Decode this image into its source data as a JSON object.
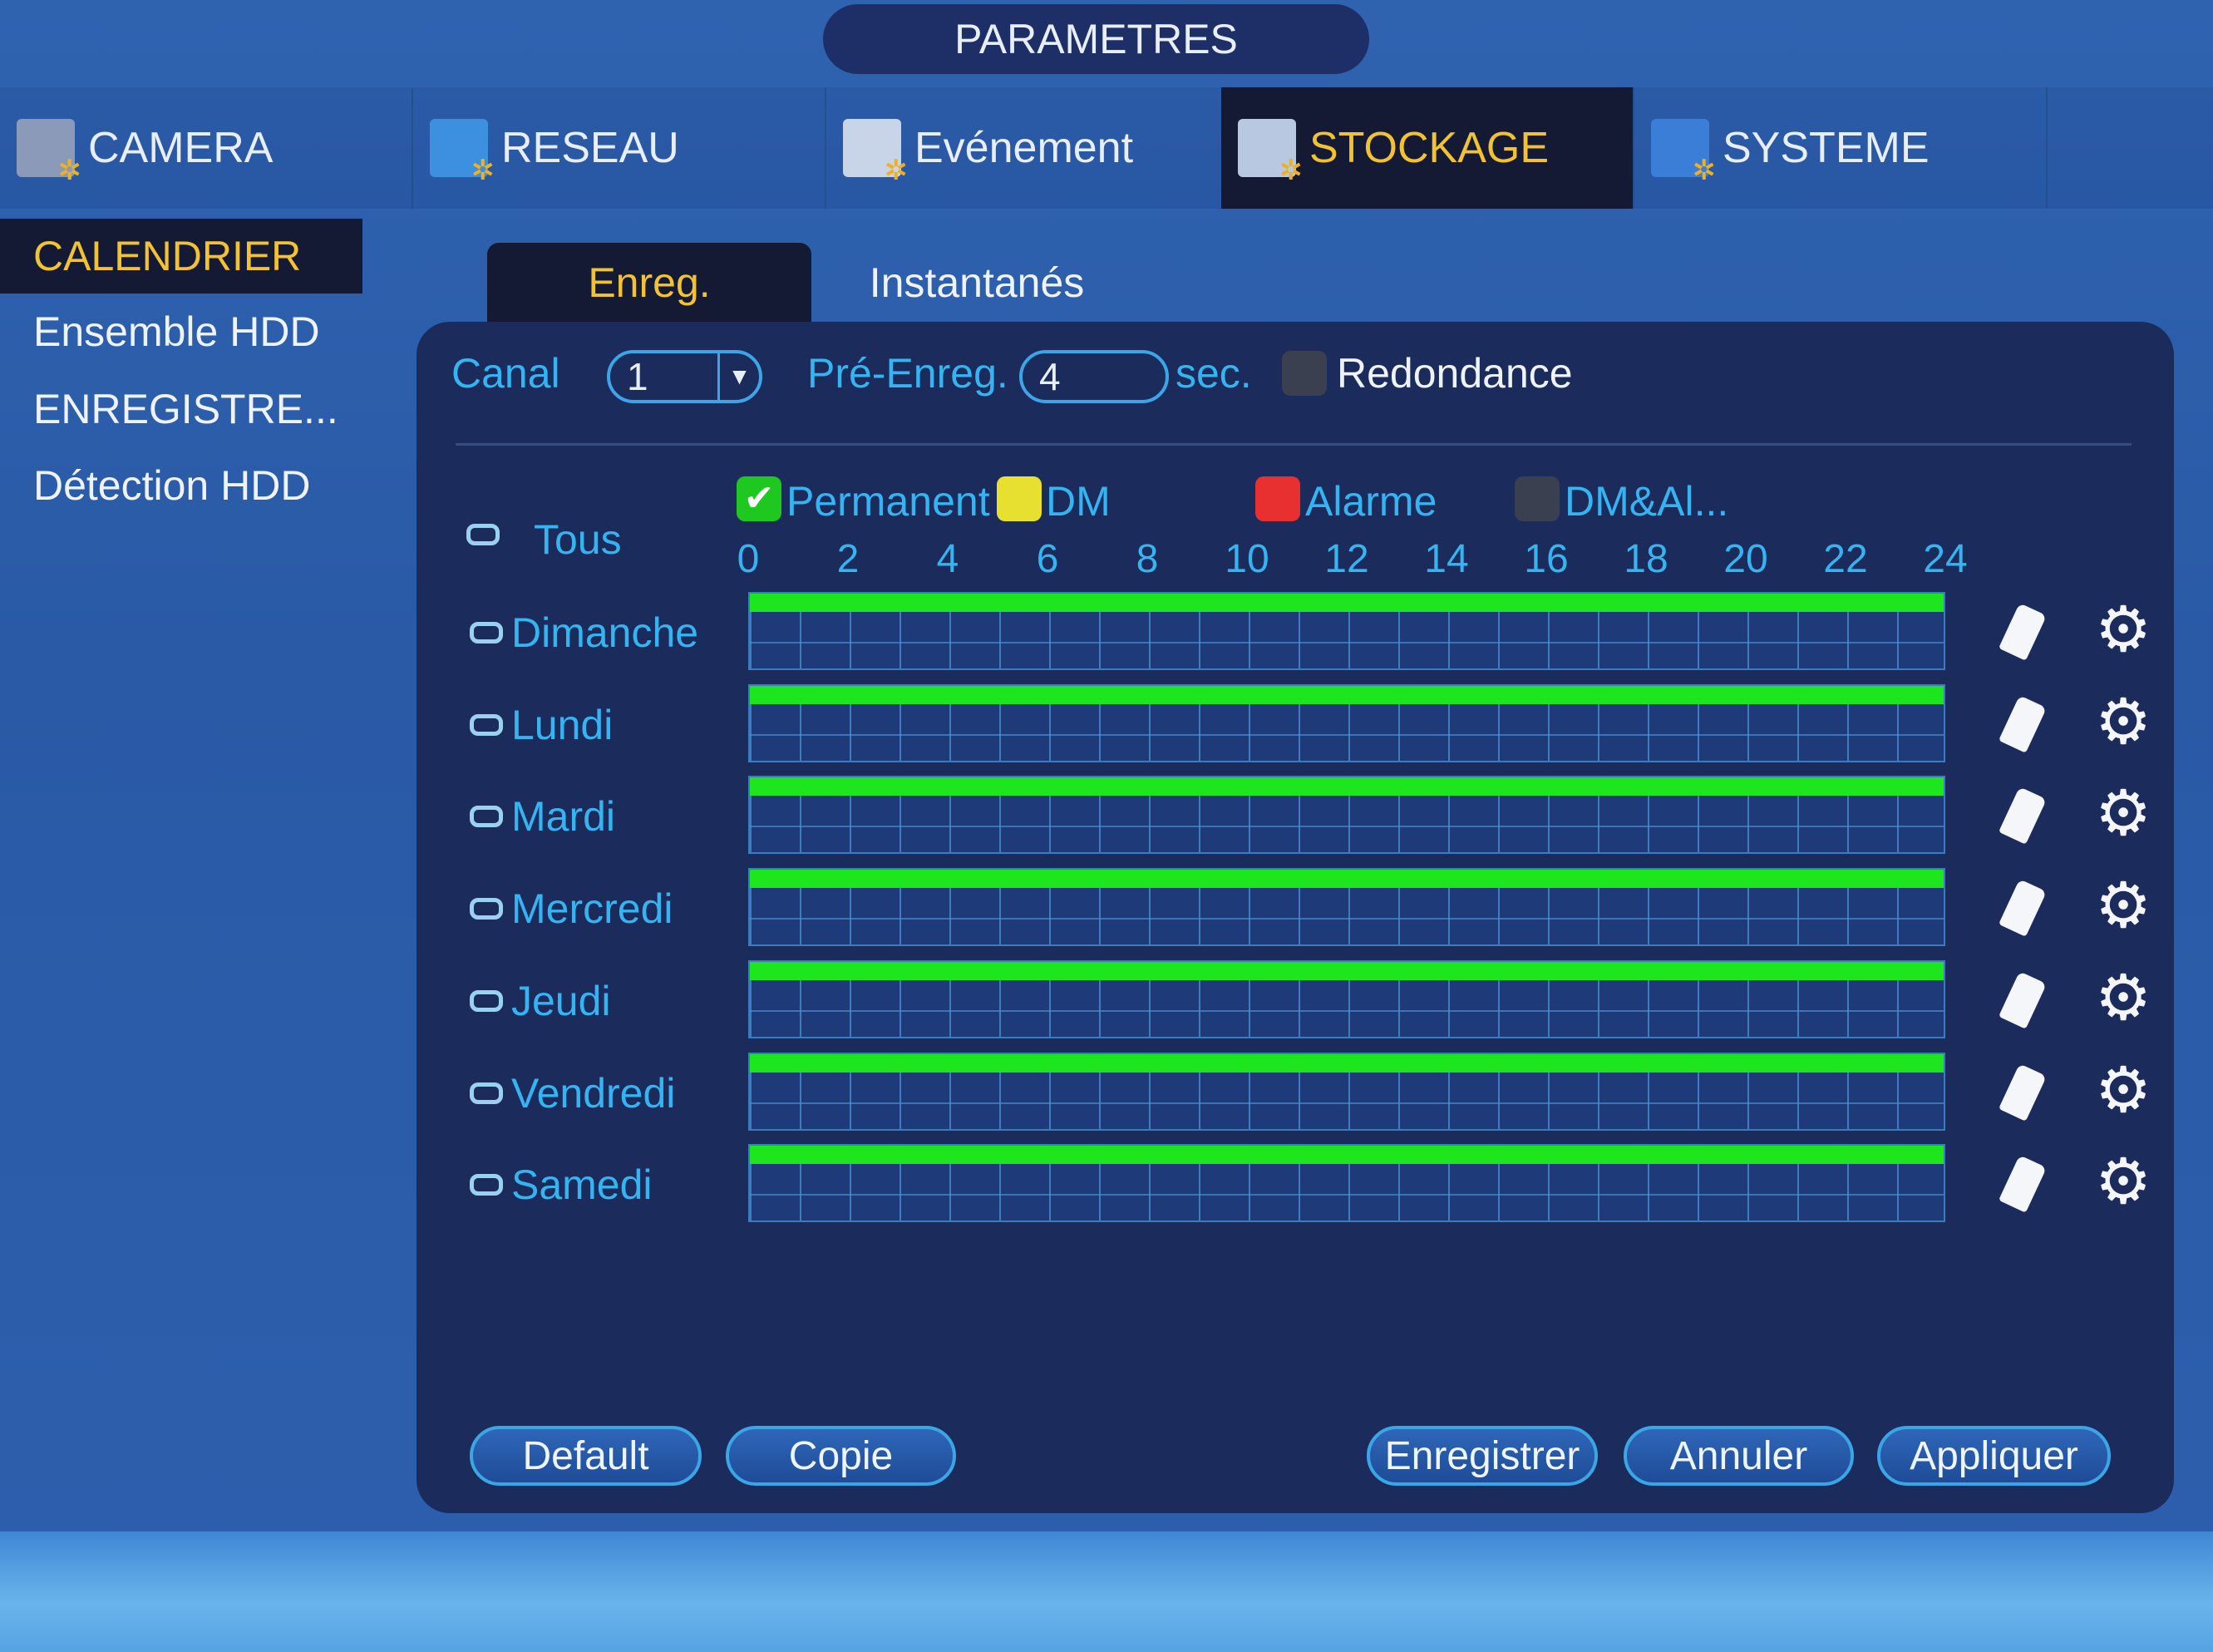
{
  "title": "PARAMETRES",
  "tabs": [
    {
      "label": "CAMERA",
      "icon": "camera-icon",
      "active": false
    },
    {
      "label": "RESEAU",
      "icon": "network-icon",
      "active": false
    },
    {
      "label": "Evénement",
      "icon": "event-icon",
      "active": false
    },
    {
      "label": "STOCKAGE",
      "icon": "storage-icon",
      "active": true
    },
    {
      "label": "SYSTEME",
      "icon": "system-icon",
      "active": false
    }
  ],
  "menu": [
    {
      "label": "CALENDRIER",
      "active": true
    },
    {
      "label": "Ensemble HDD",
      "active": false
    },
    {
      "label": "ENREGISTRE...",
      "active": false
    },
    {
      "label": "Détection HDD",
      "active": false
    }
  ],
  "subtabs": [
    {
      "label": "Enreg.",
      "active": true
    },
    {
      "label": "Instantanés",
      "active": false
    }
  ],
  "form": {
    "canal_label": "Canal",
    "canal_value": "1",
    "pre_label": "Pré-Enreg.",
    "pre_value": "4",
    "sec_label": "sec.",
    "redondance_label": "Redondance",
    "redondance_checked": false
  },
  "legend": [
    {
      "label": "Permanent",
      "color": "#1ee61e",
      "checked": true
    },
    {
      "label": "DM",
      "color": "#e8e030",
      "checked": false
    },
    {
      "label": "Alarme",
      "color": "#e83030",
      "checked": false
    },
    {
      "label": "DM&Al...",
      "color": "#3a4050",
      "checked": false
    }
  ],
  "all_label": "Tous",
  "hours": [
    "0",
    "2",
    "4",
    "6",
    "8",
    "10",
    "12",
    "14",
    "16",
    "18",
    "20",
    "22",
    "24"
  ],
  "days": [
    {
      "label": "Dimanche",
      "segments": [
        {
          "type": "Permanent",
          "start": 0,
          "end": 24
        }
      ]
    },
    {
      "label": "Lundi",
      "segments": [
        {
          "type": "Permanent",
          "start": 0,
          "end": 24
        }
      ]
    },
    {
      "label": "Mardi",
      "segments": [
        {
          "type": "Permanent",
          "start": 0,
          "end": 24
        }
      ]
    },
    {
      "label": "Mercredi",
      "segments": [
        {
          "type": "Permanent",
          "start": 0,
          "end": 24
        }
      ]
    },
    {
      "label": "Jeudi",
      "segments": [
        {
          "type": "Permanent",
          "start": 0,
          "end": 24
        }
      ]
    },
    {
      "label": "Vendredi",
      "segments": [
        {
          "type": "Permanent",
          "start": 0,
          "end": 24
        }
      ]
    },
    {
      "label": "Samedi",
      "segments": [
        {
          "type": "Permanent",
          "start": 0,
          "end": 24
        }
      ]
    }
  ],
  "buttons": {
    "default": "Default",
    "copy": "Copie",
    "save": "Enregistrer",
    "cancel": "Annuler",
    "apply": "Appliquer"
  }
}
